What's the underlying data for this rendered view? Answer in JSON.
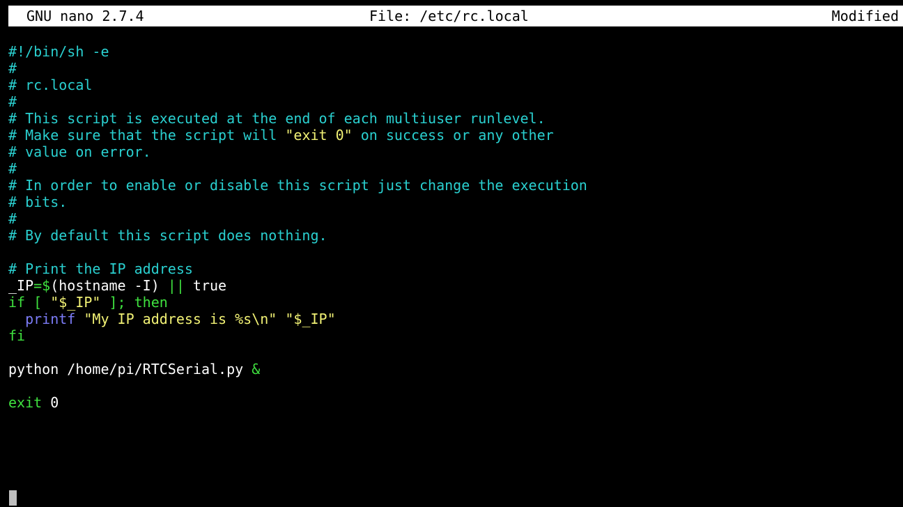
{
  "titlebar": {
    "app": "GNU nano 2.7.4",
    "file": "File: /etc/rc.local",
    "status": "Modified"
  },
  "lines": [
    {
      "segments": [
        {
          "text": "#!/bin/sh -e",
          "style": "comment"
        }
      ]
    },
    {
      "segments": [
        {
          "text": "#",
          "style": "comment"
        }
      ]
    },
    {
      "segments": [
        {
          "text": "# rc.local",
          "style": "comment"
        }
      ]
    },
    {
      "segments": [
        {
          "text": "#",
          "style": "comment"
        }
      ]
    },
    {
      "segments": [
        {
          "text": "# This script is executed at the end of each multiuser runlevel.",
          "style": "comment"
        }
      ]
    },
    {
      "segments": [
        {
          "text": "# Make sure that the script will ",
          "style": "comment"
        },
        {
          "text": "\"exit 0\"",
          "style": "string"
        },
        {
          "text": " on success or any other",
          "style": "comment"
        }
      ]
    },
    {
      "segments": [
        {
          "text": "# value on error.",
          "style": "comment"
        }
      ]
    },
    {
      "segments": [
        {
          "text": "#",
          "style": "comment"
        }
      ]
    },
    {
      "segments": [
        {
          "text": "# In order to enable or disable this script just change the execution",
          "style": "comment"
        }
      ]
    },
    {
      "segments": [
        {
          "text": "# bits.",
          "style": "comment"
        }
      ]
    },
    {
      "segments": [
        {
          "text": "#",
          "style": "comment"
        }
      ]
    },
    {
      "segments": [
        {
          "text": "# By default this script does nothing.",
          "style": "comment"
        }
      ]
    },
    {
      "segments": []
    },
    {
      "segments": [
        {
          "text": "# Print the IP address",
          "style": "comment"
        }
      ]
    },
    {
      "segments": [
        {
          "text": "_IP",
          "style": "plain"
        },
        {
          "text": "=$",
          "style": "keyword"
        },
        {
          "text": "(hostname -I) ",
          "style": "plain"
        },
        {
          "text": "||",
          "style": "keyword"
        },
        {
          "text": " true",
          "style": "plain"
        }
      ]
    },
    {
      "segments": [
        {
          "text": "if [ ",
          "style": "keyword"
        },
        {
          "text": "\"$_IP\"",
          "style": "string"
        },
        {
          "text": " ]; then",
          "style": "keyword"
        }
      ]
    },
    {
      "segments": [
        {
          "text": "  ",
          "style": "plain"
        },
        {
          "text": "printf",
          "style": "builtin"
        },
        {
          "text": " ",
          "style": "plain"
        },
        {
          "text": "\"My IP address is %s\\n\"",
          "style": "string"
        },
        {
          "text": " ",
          "style": "plain"
        },
        {
          "text": "\"$_IP\"",
          "style": "string"
        }
      ]
    },
    {
      "segments": [
        {
          "text": "fi",
          "style": "keyword"
        }
      ]
    },
    {
      "segments": []
    },
    {
      "segments": [
        {
          "text": "python /home/pi/RTCSerial.py ",
          "style": "plain"
        },
        {
          "text": "&",
          "style": "keyword"
        }
      ]
    },
    {
      "segments": []
    },
    {
      "segments": [
        {
          "text": "exit",
          "style": "keyword"
        },
        {
          "text": " 0",
          "style": "plain"
        }
      ]
    }
  ]
}
